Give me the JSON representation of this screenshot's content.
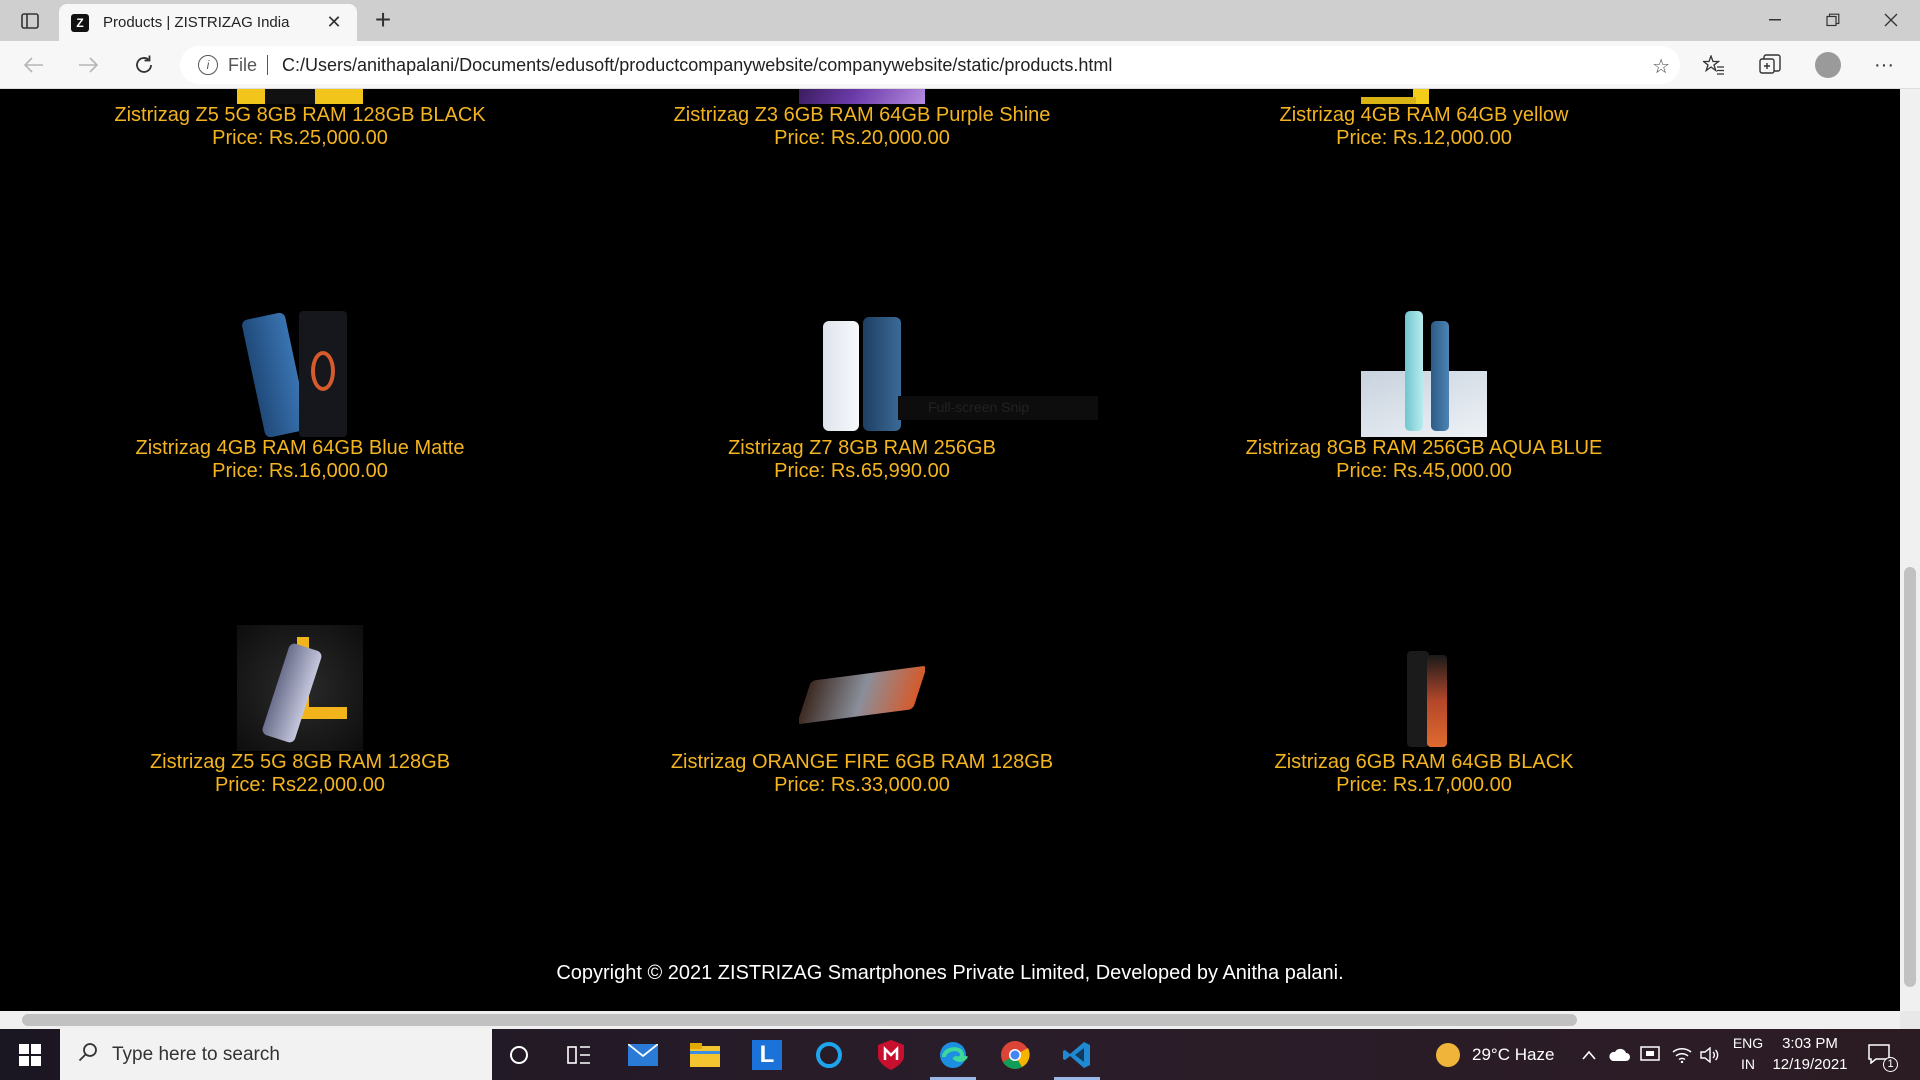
{
  "browser": {
    "tab_title": "Products | ZISTRIZAG India",
    "favicon_letter": "Z",
    "address_scheme": "File",
    "url": "C:/Users/anithapalani/Documents/edusoft/productcompanywebsite/companywebsite/static/products.html"
  },
  "products": [
    {
      "name": "Zistrizag Z5 5G 8GB RAM 128GB BLACK",
      "price": "Price: Rs.25,000.00"
    },
    {
      "name": "Zistrizag Z3 6GB RAM 64GB Purple Shine",
      "price": "Price: Rs.20,000.00"
    },
    {
      "name": "Zistrizag 4GB RAM 64GB yellow",
      "price": "Price: Rs.12,000.00"
    },
    {
      "name": "Zistrizag 4GB RAM 64GB Blue Matte",
      "price": "Price: Rs.16,000.00"
    },
    {
      "name": "Zistrizag Z7 8GB RAM 256GB",
      "price": "Price: Rs.65,990.00"
    },
    {
      "name": "Zistrizag 8GB RAM 256GB AQUA BLUE",
      "price": "Price: Rs.45,000.00"
    },
    {
      "name": "Zistrizag Z5 5G 8GB RAM 128GB",
      "price": "Price: Rs22,000.00"
    },
    {
      "name": "Zistrizag ORANGE FIRE 6GB RAM 128GB",
      "price": "Price: Rs.33,000.00"
    },
    {
      "name": "Zistrizag 6GB RAM 64GB BLACK",
      "price": "Price: Rs.17,000.00"
    }
  ],
  "tooltip": "Full-screen Snip",
  "footer": "Copyright © 2021 ZISTRIZAG Smartphones Private Limited, Developed by Anitha palani.",
  "taskbar": {
    "search_placeholder": "Type here to search",
    "weather": "29°C  Haze",
    "language_line1": "ENG",
    "language_line2": "IN",
    "time": "3:03 PM",
    "date": "12/19/2021",
    "notification_count": "1"
  },
  "colors": {
    "accent_gold": "#f3b41f",
    "page_bg": "#000000"
  }
}
